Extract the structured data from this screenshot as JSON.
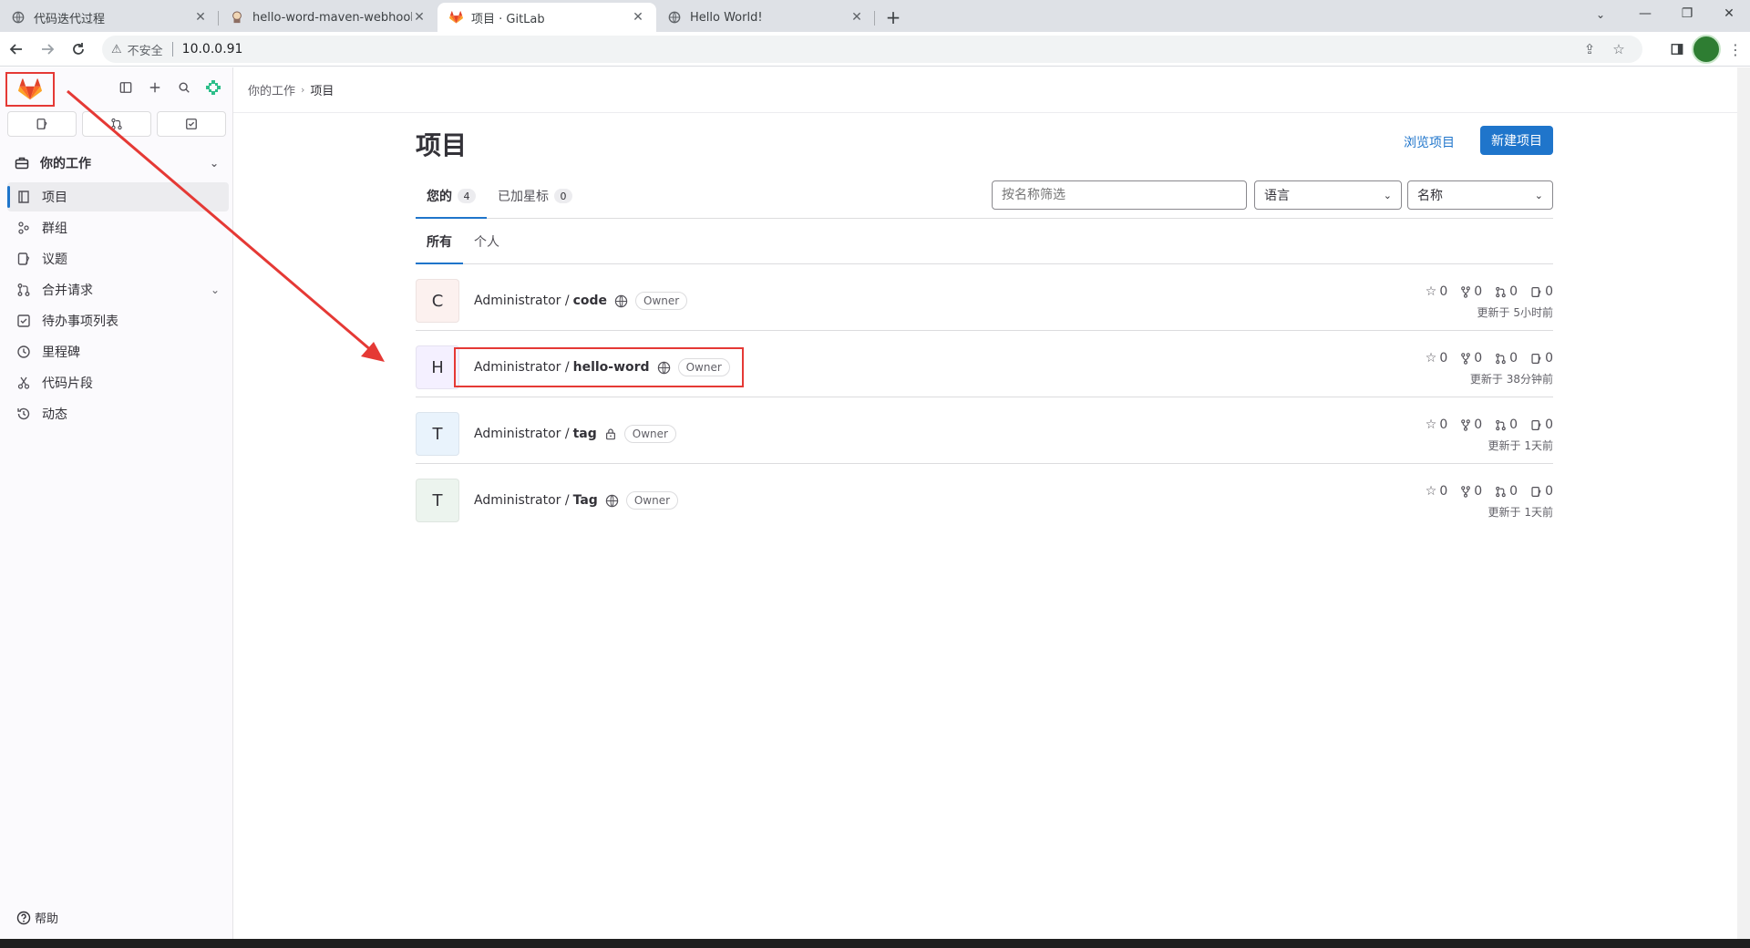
{
  "browser": {
    "tabs": [
      {
        "title": "代码迭代过程",
        "favicon": "globe-icon",
        "active": false
      },
      {
        "title": "hello-word-maven-webhook [",
        "favicon": "jenkins-icon",
        "active": false
      },
      {
        "title": "项目 · GitLab",
        "favicon": "gitlab-icon",
        "active": true
      },
      {
        "title": "Hello World!",
        "favicon": "globe-icon",
        "active": false
      }
    ],
    "address": {
      "security_label": "不安全",
      "url": "10.0.0.91"
    }
  },
  "sidebar": {
    "section_title": "你的工作",
    "items": [
      {
        "label": "项目",
        "icon": "project-icon",
        "active": true
      },
      {
        "label": "群组",
        "icon": "group-icon"
      },
      {
        "label": "议题",
        "icon": "issues-icon"
      },
      {
        "label": "合并请求",
        "icon": "merge-request-icon",
        "has_chevron": true
      },
      {
        "label": "待办事项列表",
        "icon": "todo-icon"
      },
      {
        "label": "里程碑",
        "icon": "milestone-icon"
      },
      {
        "label": "代码片段",
        "icon": "snippet-icon"
      },
      {
        "label": "动态",
        "icon": "activity-icon"
      }
    ],
    "help_label": "帮助"
  },
  "breadcrumb": {
    "parent": "你的工作",
    "current": "项目"
  },
  "page": {
    "title": "项目",
    "explore_label": "浏览项目",
    "new_label": "新建项目",
    "tabs": [
      {
        "label": "您的",
        "count": "4",
        "active": true
      },
      {
        "label": "已加星标",
        "count": "0",
        "active": false
      }
    ],
    "filter_placeholder": "按名称筛选",
    "language_select": "语言",
    "sort_select": "名称",
    "subtabs": [
      {
        "label": "所有",
        "active": true
      },
      {
        "label": "个人",
        "active": false
      }
    ]
  },
  "projects": [
    {
      "initial": "C",
      "namespace": "Administrator /",
      "name": "code",
      "visibility": "public",
      "role": "Owner",
      "stars": "0",
      "forks": "0",
      "mrs": "0",
      "issues": "0",
      "updated": "更新于 5小时前",
      "avatar_color": "#fcf1ef"
    },
    {
      "initial": "H",
      "namespace": "Administrator /",
      "name": "hello-word",
      "visibility": "public",
      "role": "Owner",
      "stars": "0",
      "forks": "0",
      "mrs": "0",
      "issues": "0",
      "updated": "更新于 38分钟前",
      "avatar_color": "#f4f0ff"
    },
    {
      "initial": "T",
      "namespace": "Administrator /",
      "name": "tag",
      "visibility": "private",
      "role": "Owner",
      "stars": "0",
      "forks": "0",
      "mrs": "0",
      "issues": "0",
      "updated": "更新于 1天前",
      "avatar_color": "#e9f3fc"
    },
    {
      "initial": "T",
      "namespace": "Administrator /",
      "name": "Tag",
      "visibility": "public",
      "role": "Owner",
      "stars": "0",
      "forks": "0",
      "mrs": "0",
      "issues": "0",
      "updated": "更新于 1天前",
      "avatar_color": "#ecf4ee"
    }
  ],
  "colors": {
    "accent": "#1f75cb",
    "annotation": "#e53935",
    "gitlab_orange": "#e24329"
  }
}
